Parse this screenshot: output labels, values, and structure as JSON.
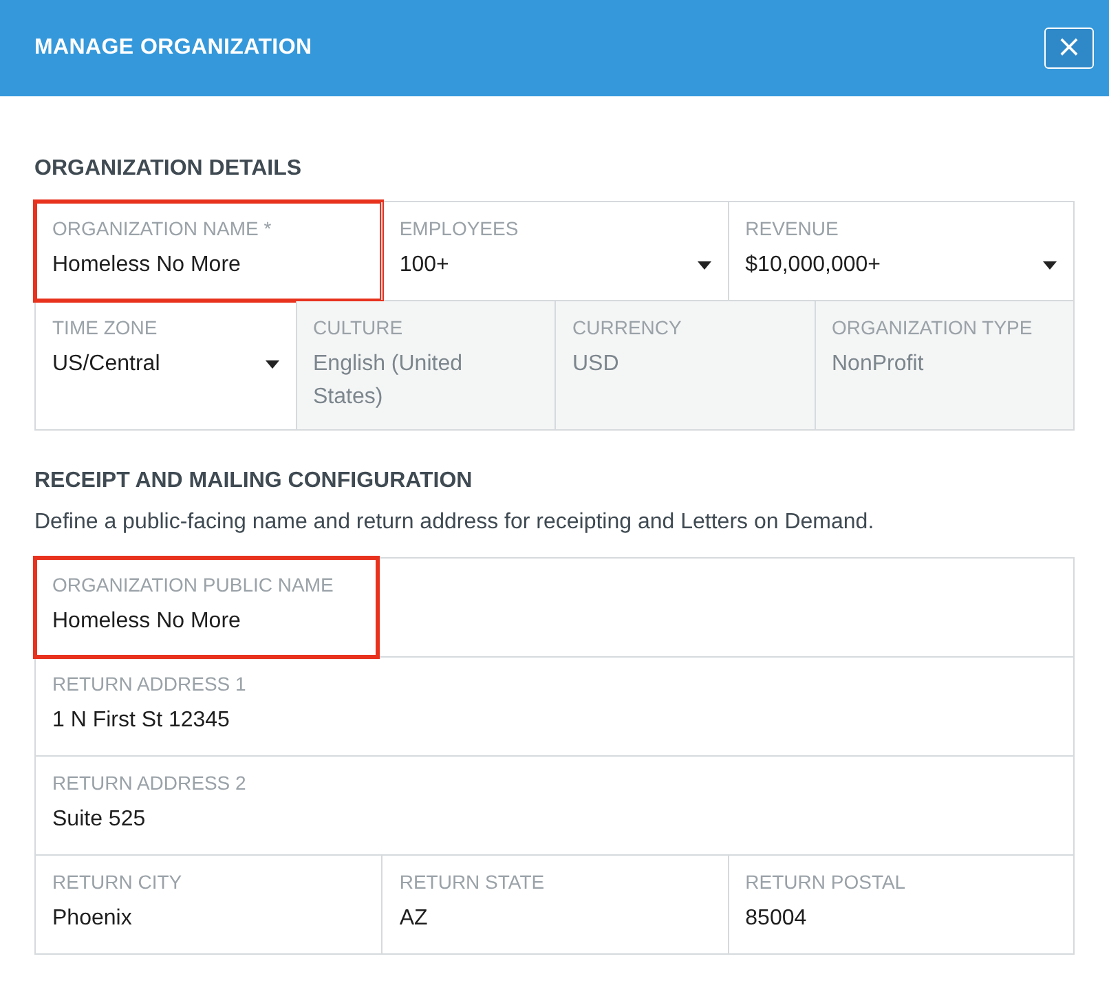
{
  "dialog": {
    "title": "MANAGE ORGANIZATION",
    "close": "×"
  },
  "details": {
    "heading": "ORGANIZATION DETAILS",
    "rows": [
      [
        {
          "label": "ORGANIZATION NAME *",
          "value": "Homeless No More",
          "kind": "text",
          "highlighted": true
        },
        {
          "label": "EMPLOYEES",
          "value": "100+",
          "kind": "select",
          "highlighted": false
        },
        {
          "label": "REVENUE",
          "value": "$10,000,000+",
          "kind": "select",
          "highlighted": false
        }
      ],
      [
        {
          "label": "TIME ZONE",
          "value": "US/Central",
          "kind": "select",
          "highlighted": false
        },
        {
          "label": "CULTURE",
          "value": "English (United States)",
          "kind": "readonly",
          "highlighted": false
        },
        {
          "label": "CURRENCY",
          "value": "USD",
          "kind": "readonly",
          "highlighted": false
        },
        {
          "label": "ORGANIZATION TYPE",
          "value": "NonProfit",
          "kind": "readonly",
          "highlighted": false
        }
      ]
    ]
  },
  "mailing": {
    "heading": "RECEIPT AND MAILING CONFIGURATION",
    "description": "Define a public-facing name and return address for receipting and Letters on Demand.",
    "rows": [
      [
        {
          "label": "ORGANIZATION PUBLIC NAME",
          "value": "Homeless No More",
          "kind": "text",
          "highlighted": true
        }
      ],
      [
        {
          "label": "RETURN ADDRESS 1",
          "value": "1 N First St 12345",
          "kind": "text",
          "highlighted": false
        }
      ],
      [
        {
          "label": "RETURN ADDRESS 2",
          "value": "Suite 525",
          "kind": "text",
          "highlighted": false
        }
      ],
      [
        {
          "label": "RETURN CITY",
          "value": "Phoenix",
          "kind": "text",
          "highlighted": false
        },
        {
          "label": "RETURN STATE",
          "value": "AZ",
          "kind": "text",
          "highlighted": false
        },
        {
          "label": "RETURN POSTAL",
          "value": "85004",
          "kind": "text",
          "highlighted": false
        }
      ]
    ]
  }
}
